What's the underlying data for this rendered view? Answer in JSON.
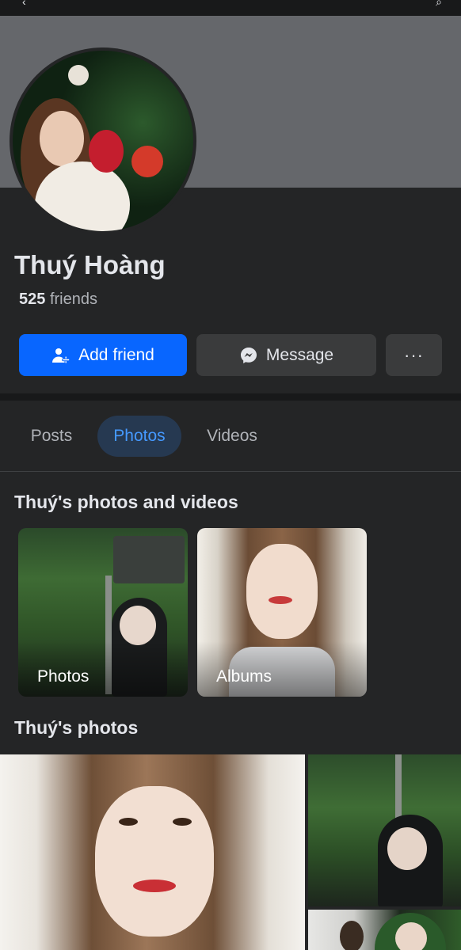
{
  "profile": {
    "name": "Thuý Hoàng",
    "friends_count": "525",
    "friends_label": "friends"
  },
  "actions": {
    "add_friend": "Add friend",
    "message": "Message",
    "more": "···"
  },
  "tabs": [
    {
      "label": "Posts",
      "selected": false
    },
    {
      "label": "Photos",
      "selected": true
    },
    {
      "label": "Videos",
      "selected": false
    }
  ],
  "sections": {
    "photos_and_videos_title": "Thuý's photos and videos",
    "photos_title": "Thuý's photos"
  },
  "cards": [
    {
      "label": "Photos"
    },
    {
      "label": "Albums"
    }
  ],
  "colors": {
    "background": "#242526",
    "primary_button": "#0866ff",
    "selected_tab_bg": "#263951",
    "selected_tab_text": "#4599ff"
  },
  "icons": {
    "add_friend": "add-friend-icon",
    "message": "messenger-icon",
    "more": "more-icon"
  }
}
